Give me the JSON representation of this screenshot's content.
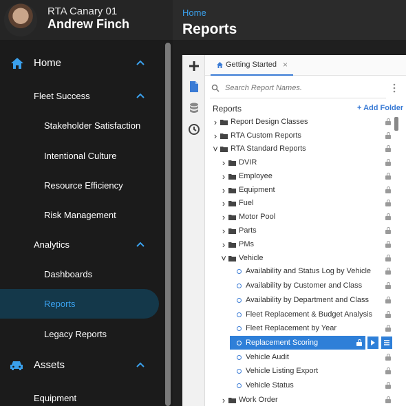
{
  "profile": {
    "org": "RTA Canary 01",
    "user": "Andrew Finch"
  },
  "nav": {
    "home": "Home",
    "fleet_success": "Fleet Success",
    "stakeholder": "Stakeholder Satisfaction",
    "intentional": "Intentional Culture",
    "resource": "Resource Efficiency",
    "risk": "Risk Management",
    "analytics": "Analytics",
    "dashboards": "Dashboards",
    "reports": "Reports",
    "legacy": "Legacy Reports",
    "assets": "Assets",
    "equipment": "Equipment"
  },
  "header": {
    "breadcrumb": "Home",
    "title": "Reports"
  },
  "tab": {
    "label": "Getting Started",
    "close": "×"
  },
  "search": {
    "placeholder": "Search Report Names."
  },
  "reports_panel": {
    "heading": "Reports",
    "add_folder": "+ Add Folder"
  },
  "tree": [
    {
      "label": "Report Design Classes",
      "caret": ">"
    },
    {
      "label": "RTA Custom Reports",
      "caret": ">"
    },
    {
      "label": "RTA Standard Reports",
      "caret": "v"
    },
    {
      "label": "DVIR",
      "caret": ">"
    },
    {
      "label": "Employee",
      "caret": ">"
    },
    {
      "label": "Equipment",
      "caret": ">"
    },
    {
      "label": "Fuel",
      "caret": ">"
    },
    {
      "label": "Motor Pool",
      "caret": ">"
    },
    {
      "label": "Parts",
      "caret": ">"
    },
    {
      "label": "PMs",
      "caret": ">"
    },
    {
      "label": "Vehicle",
      "caret": "v"
    },
    {
      "label": "Availability and Status Log by Vehicle"
    },
    {
      "label": "Availability by Customer and Class"
    },
    {
      "label": "Availability by Department and Class"
    },
    {
      "label": "Fleet Replacement & Budget Analysis"
    },
    {
      "label": "Fleet Replacement by Year"
    },
    {
      "label": "Replacement Scoring"
    },
    {
      "label": "Vehicle Audit"
    },
    {
      "label": "Vehicle Listing Export"
    },
    {
      "label": "Vehicle Status"
    },
    {
      "label": "Work Order",
      "caret": ">"
    }
  ],
  "colors": {
    "accent": "#3aa0ec",
    "selected": "#2e7fd8",
    "active_bg": "#14384a"
  }
}
